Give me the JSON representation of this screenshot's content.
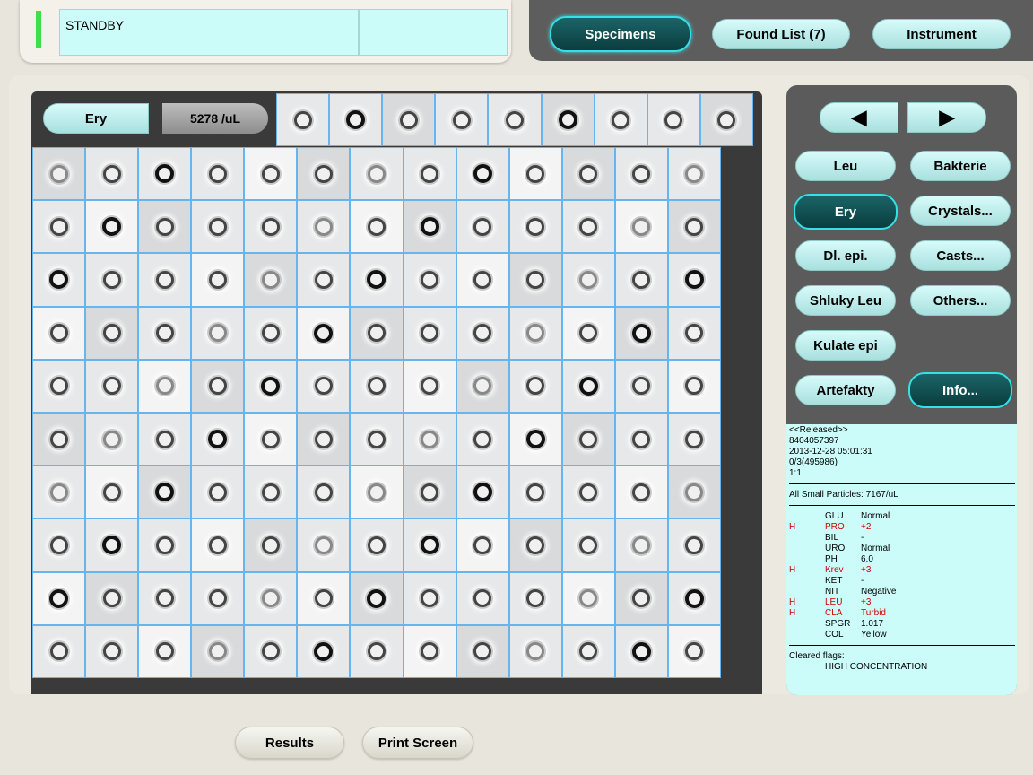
{
  "status": {
    "text": "STANDBY",
    "secondary": ""
  },
  "nav": {
    "specimens": "Specimens",
    "found_list": "Found List (7)",
    "instrument": "Instrument"
  },
  "grid_header": {
    "class_label": "Ery",
    "count": "5278 /uL"
  },
  "categories": {
    "leu": "Leu",
    "bakterie": "Bakterie",
    "ery": "Ery",
    "crystals": "Crystals...",
    "dl_epi": "Dl. epi.",
    "casts": "Casts...",
    "shluky_leu": "Shluky Leu",
    "others": "Others...",
    "kulate_epi": "Kulate epi",
    "artefakty": "Artefakty",
    "info": "Info..."
  },
  "nav_arrows": {
    "prev_icon": "arrow-left-icon",
    "next_icon": "arrow-right-icon",
    "prev": "◀",
    "next": "▶"
  },
  "specimen_info": {
    "state": "<<Released>>",
    "id": "8404057397",
    "datetime": "2013-12-28 05:01:31",
    "rack": "0/3(495986)",
    "dilution": "1:1",
    "small_particles": "All Small Particles: 7167/uL"
  },
  "urinalysis": [
    {
      "flag": "",
      "name": "GLU",
      "value": "Normal",
      "abnormal": false
    },
    {
      "flag": "H",
      "name": "PRO",
      "value": "+2",
      "abnormal": true
    },
    {
      "flag": "",
      "name": "BIL",
      "value": "-",
      "abnormal": false
    },
    {
      "flag": "",
      "name": "URO",
      "value": "Normal",
      "abnormal": false
    },
    {
      "flag": "",
      "name": "PH",
      "value": "6.0",
      "abnormal": false
    },
    {
      "flag": "H",
      "name": "Krev",
      "value": "+3",
      "abnormal": true
    },
    {
      "flag": "",
      "name": "KET",
      "value": "-",
      "abnormal": false
    },
    {
      "flag": "",
      "name": "NIT",
      "value": "Negative",
      "abnormal": false
    },
    {
      "flag": "H",
      "name": "LEU",
      "value": "+3",
      "abnormal": true
    },
    {
      "flag": "H",
      "name": "CLA",
      "value": "Turbid",
      "abnormal": true
    },
    {
      "flag": "",
      "name": "SPGR",
      "value": "1.017",
      "abnormal": false
    },
    {
      "flag": "",
      "name": "COL",
      "value": "Yellow",
      "abnormal": false
    }
  ],
  "cleared_flags": {
    "label": "Cleared flags:",
    "items": [
      "HIGH CONCENTRATION"
    ]
  },
  "bottom": {
    "results": "Results",
    "print_screen": "Print Screen"
  }
}
